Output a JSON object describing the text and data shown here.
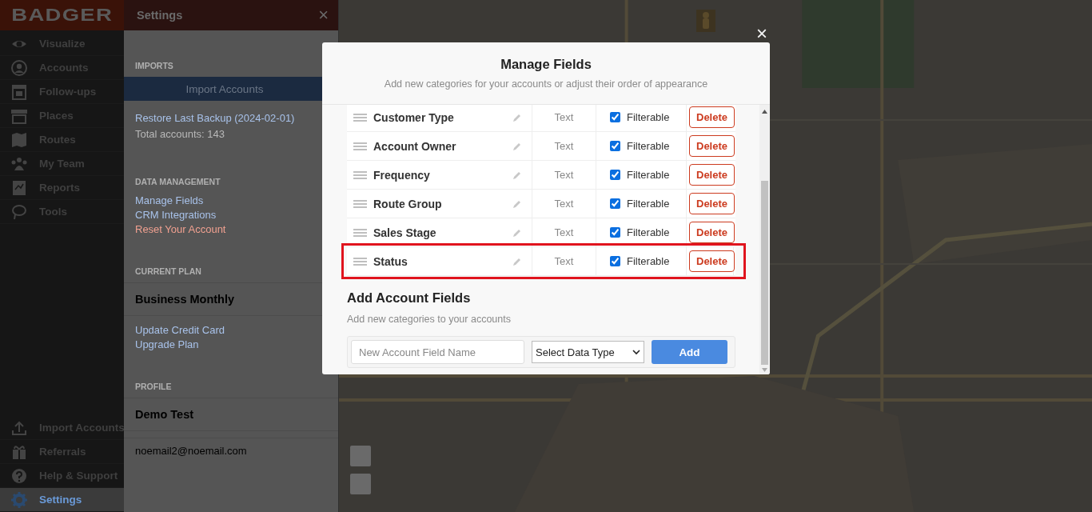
{
  "sidebar": {
    "logo": "BADGER",
    "items": [
      {
        "label": "Visualize",
        "selected": false
      },
      {
        "label": "Accounts",
        "selected": false
      },
      {
        "label": "Follow-ups",
        "selected": false
      },
      {
        "label": "Places",
        "selected": false
      },
      {
        "label": "Routes",
        "selected": false
      },
      {
        "label": "My Team",
        "selected": false
      },
      {
        "label": "Reports",
        "selected": false
      },
      {
        "label": "Tools",
        "selected": false
      }
    ],
    "bottom_items": [
      {
        "label": "Import Accounts",
        "selected": false
      },
      {
        "label": "Referrals",
        "selected": false
      },
      {
        "label": "Help & Support",
        "selected": false
      },
      {
        "label": "Settings",
        "selected": true
      }
    ]
  },
  "settings_panel": {
    "title": "Settings",
    "close": "×",
    "sections": [
      {
        "heading": "IMPORTS",
        "items": [
          {
            "kind": "button",
            "text": "Import Accounts"
          },
          {
            "kind": "link",
            "text": "Restore Last Backup (2024-02-01)"
          },
          {
            "kind": "note",
            "text": "Total accounts: 143"
          }
        ]
      },
      {
        "heading": "DATA MANAGEMENT",
        "items": [
          {
            "kind": "link",
            "text": "Manage Fields"
          },
          {
            "kind": "link",
            "text": "CRM Integrations"
          },
          {
            "kind": "danger",
            "text": "Reset Your Account"
          }
        ]
      },
      {
        "heading": "CURRENT PLAN",
        "items": [
          {
            "kind": "title",
            "text": "Business Monthly"
          },
          {
            "kind": "link",
            "text": "Update Credit Card"
          },
          {
            "kind": "link",
            "text": "Upgrade Plan"
          }
        ]
      },
      {
        "heading": "PROFILE",
        "items": [
          {
            "kind": "title",
            "text": "Demo Test"
          },
          {
            "kind": "text",
            "text": "noemail2@noemail.com"
          }
        ]
      }
    ]
  },
  "modal": {
    "close": "×",
    "title": "Manage Fields",
    "subtitle": "Add new categories for your accounts or adjust their order of appearance",
    "fields": [
      {
        "name": "Customer Type",
        "type": "Text",
        "filterable": true,
        "filter_label": "Filterable",
        "delete_label": "Delete",
        "highlighted": false
      },
      {
        "name": "Account Owner",
        "type": "Text",
        "filterable": true,
        "filter_label": "Filterable",
        "delete_label": "Delete",
        "highlighted": false
      },
      {
        "name": "Frequency",
        "type": "Text",
        "filterable": true,
        "filter_label": "Filterable",
        "delete_label": "Delete",
        "highlighted": false
      },
      {
        "name": "Route Group",
        "type": "Text",
        "filterable": true,
        "filter_label": "Filterable",
        "delete_label": "Delete",
        "highlighted": false
      },
      {
        "name": "Sales Stage",
        "type": "Text",
        "filterable": true,
        "filter_label": "Filterable",
        "delete_label": "Delete",
        "highlighted": false
      },
      {
        "name": "Status",
        "type": "Text",
        "filterable": true,
        "filter_label": "Filterable",
        "delete_label": "Delete",
        "highlighted": true
      }
    ],
    "add_section": {
      "title": "Add Account Fields",
      "subtitle": "Add new categories to your accounts",
      "name_field": {
        "placeholder": "New Account Field Name"
      },
      "type_select": {
        "value": "Select Data Type"
      },
      "add_button": "Add"
    }
  }
}
